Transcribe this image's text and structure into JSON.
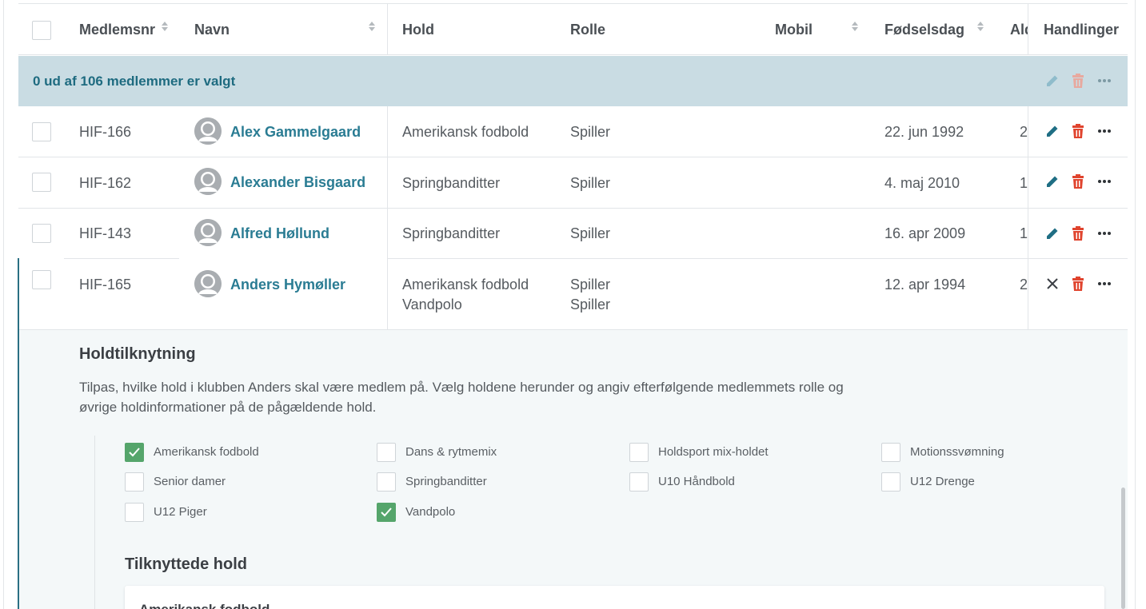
{
  "table": {
    "columns": {
      "member_no": "Medlemsnr",
      "name": "Navn",
      "team": "Hold",
      "role": "Rolle",
      "mobile": "Mobil",
      "birthday": "Fødselsdag",
      "age": "Ald",
      "actions": "Handlinger"
    },
    "selection_text": "0 ud af 106 medlemmer er valgt",
    "rows": [
      {
        "member_no": "HIF-166",
        "name": "Alex Gammelgaard",
        "teams": [
          "Amerikansk fodbold"
        ],
        "roles": [
          "Spiller"
        ],
        "mobile": "",
        "birthday": "22. jun 1992",
        "age": "2"
      },
      {
        "member_no": "HIF-162",
        "name": "Alexander Bisgaard",
        "teams": [
          "Springbanditter"
        ],
        "roles": [
          "Spiller"
        ],
        "mobile": "",
        "birthday": "4. maj 2010",
        "age": "1"
      },
      {
        "member_no": "HIF-143",
        "name": "Alfred Høllund",
        "teams": [
          "Springbanditter"
        ],
        "roles": [
          "Spiller"
        ],
        "mobile": "",
        "birthday": "16. apr 2009",
        "age": "1"
      },
      {
        "member_no": "HIF-165",
        "name": "Anders Hymøller",
        "teams": [
          "Amerikansk fodbold",
          "Vandpolo"
        ],
        "roles": [
          "Spiller",
          "Spiller"
        ],
        "mobile": "",
        "birthday": "12. apr 1994",
        "age": "2"
      }
    ]
  },
  "icons": {
    "edit": "pencil-icon",
    "delete": "trash-icon",
    "more": "ellipsis-icon",
    "close": "close-icon",
    "sort": "sort-icon",
    "avatar": "user-avatar-icon"
  },
  "colors": {
    "accent": "#2a7c93",
    "selection_bar": "#c9dce3",
    "delete": "#e0442e",
    "delete_disabled": "#e8a99f",
    "check": "#55a56b"
  },
  "expanded": {
    "title": "Holdtilknytning",
    "description": "Tilpas, hvilke hold i klubben Anders skal være medlem på. Vælg holdene herunder og angiv efterfølgende medlemmets rolle og øvrige holdinformationer på de pågældende hold.",
    "teams": [
      {
        "label": "Amerikansk fodbold",
        "checked": true
      },
      {
        "label": "Dans & rytmemix",
        "checked": false
      },
      {
        "label": "Holdsport mix-holdet",
        "checked": false
      },
      {
        "label": "Motionssvømning",
        "checked": false
      },
      {
        "label": "Senior damer",
        "checked": false
      },
      {
        "label": "Springbanditter",
        "checked": false
      },
      {
        "label": "U10 Håndbold",
        "checked": false
      },
      {
        "label": "U12 Drenge",
        "checked": false
      },
      {
        "label": "U12 Piger",
        "checked": false
      },
      {
        "label": "Vandpolo",
        "checked": true
      }
    ],
    "linked_title": "Tilknyttede hold",
    "linked_first_card": "Amerikansk fodbold"
  }
}
